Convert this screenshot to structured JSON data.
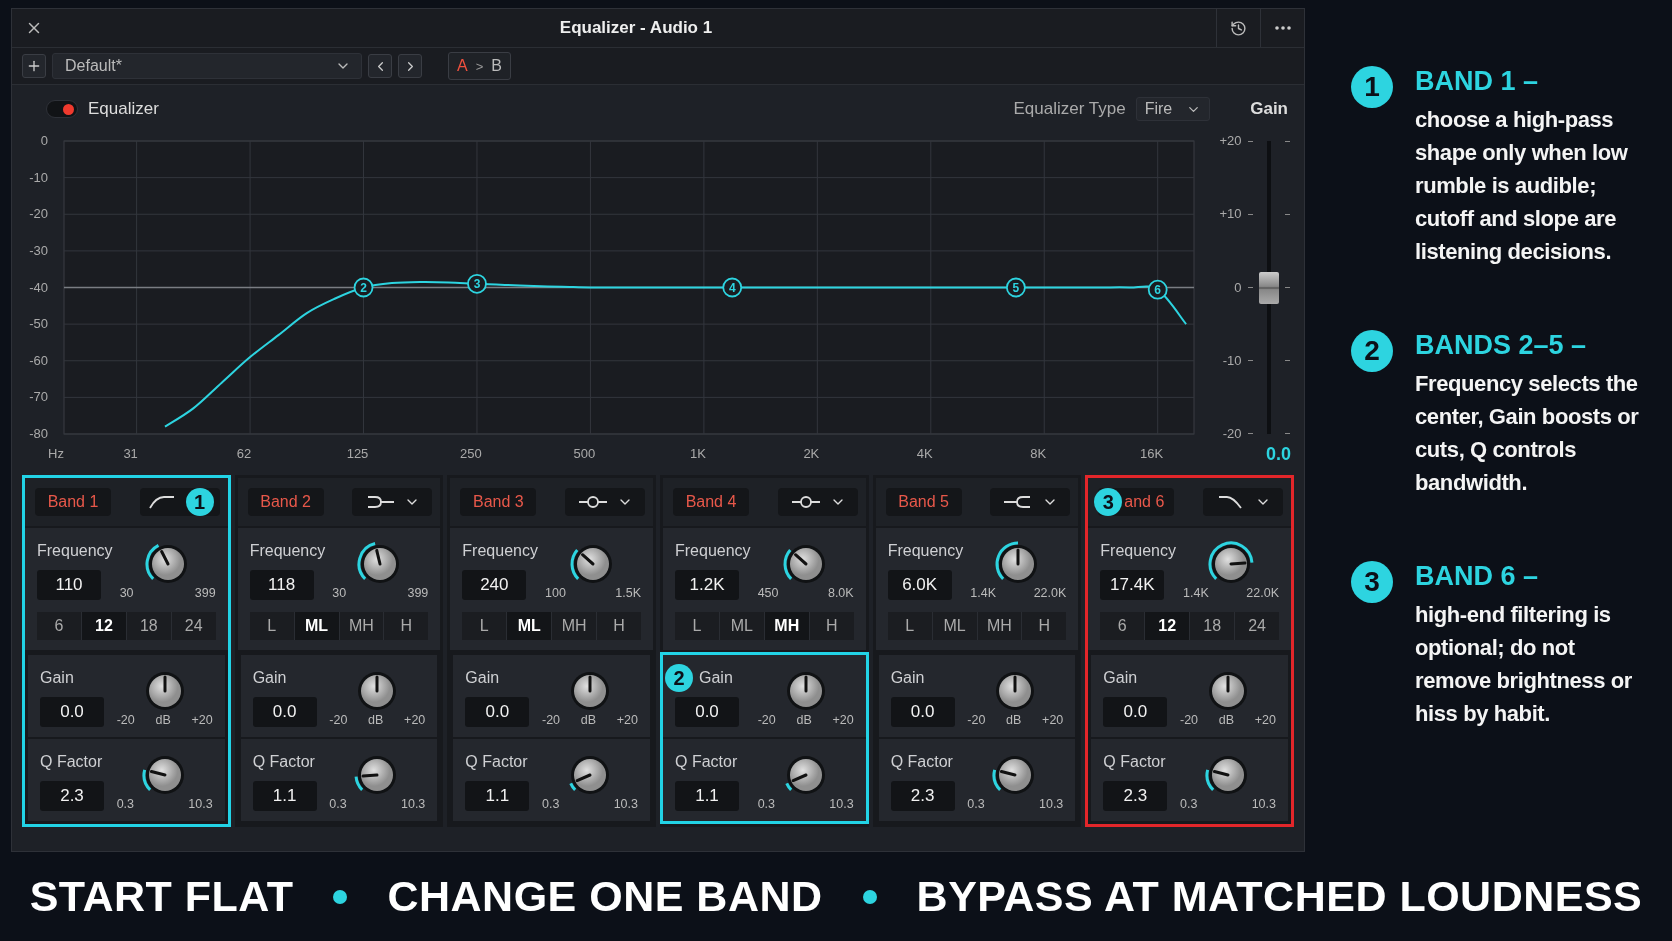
{
  "window": {
    "title": "Equalizer - Audio 1"
  },
  "toolbar": {
    "preset": "Default*",
    "compare": {
      "items": [
        {
          "label": "A",
          "selected": true
        },
        {
          "label": "B",
          "selected": false
        }
      ],
      "separator": ">"
    }
  },
  "equalizer": {
    "label": "Equalizer",
    "on": true,
    "type_label": "Equalizer Type",
    "type_value": "Fire",
    "gain_label": "Gain"
  },
  "graph": {
    "chart_data": {
      "type": "line",
      "xlabel": "Hz",
      "ylim": [
        -80,
        0
      ],
      "grid": true,
      "ref_lines": [
        {
          "axis": "y",
          "value": -40
        }
      ],
      "categories": [
        "31",
        null,
        null,
        null,
        "62",
        null,
        null,
        null,
        "125",
        null,
        null,
        null,
        "250",
        null,
        null,
        null,
        "500",
        null,
        null,
        null,
        "1K",
        null,
        null,
        null,
        "2K",
        null,
        null,
        null,
        "4K",
        null,
        null,
        null,
        "8K",
        null,
        null,
        null,
        "16K",
        null
      ],
      "yticks": [
        0,
        -10,
        -20,
        -30,
        -40,
        -50,
        -60,
        -70,
        -80
      ],
      "series": [
        {
          "color": "#2dd4e0",
          "values": [
            null,
            -78,
            -73,
            -66,
            -59,
            -53,
            -47,
            -43,
            -40,
            -38.8,
            -38.5,
            -38.6,
            -39,
            -39.3,
            -39.6,
            -39.8,
            -40,
            -40,
            -40,
            -40,
            -40,
            -40,
            -40,
            -40,
            -40,
            -40,
            -40,
            -40,
            -40,
            -40,
            -40,
            -40,
            -40,
            -40,
            -40,
            -40,
            -40.6,
            -50
          ]
        }
      ],
      "annotations": [
        "2",
        "3",
        "4",
        "5",
        "6"
      ]
    }
  },
  "gain_fader": {
    "scale": [
      "+20",
      "+10",
      "0",
      "-10",
      "-20"
    ],
    "level": 0.5,
    "reading": "0.0"
  },
  "bands": [
    {
      "label": "Band 1",
      "filter": {
        "kind": "highpass",
        "badge": "1"
      },
      "highlight": {
        "color": "#22d3e6"
      },
      "frequency": {
        "label": "Frequency",
        "value": "110",
        "min": "30",
        "max": "399"
      },
      "options": [
        {
          "label": "6",
          "selected": false
        },
        {
          "label": "12",
          "selected": true
        },
        {
          "label": "18",
          "selected": false
        },
        {
          "label": "24",
          "selected": false
        }
      ],
      "gain": {
        "label": "Gain",
        "value": "0.0",
        "min": "-20",
        "unit": "dB",
        "max": "+20"
      },
      "q": {
        "label": "Q Factor",
        "value": "2.3",
        "min": "0.3",
        "max": "10.3"
      }
    },
    {
      "label": "Band 2",
      "filter": {
        "kind": "lowshelf"
      },
      "frequency": {
        "label": "Frequency",
        "value": "118",
        "min": "30",
        "max": "399"
      },
      "options": [
        {
          "label": "L",
          "selected": false
        },
        {
          "label": "ML",
          "selected": true
        },
        {
          "label": "MH",
          "selected": false
        },
        {
          "label": "H",
          "selected": false
        }
      ],
      "gain": {
        "label": "Gain",
        "value": "0.0",
        "min": "-20",
        "unit": "dB",
        "max": "+20"
      },
      "q": {
        "label": "Q Factor",
        "value": "1.1",
        "min": "0.3",
        "max": "10.3"
      }
    },
    {
      "label": "Band 3",
      "filter": {
        "kind": "bell"
      },
      "frequency": {
        "label": "Frequency",
        "value": "240",
        "min": "100",
        "max": "1.5K"
      },
      "options": [
        {
          "label": "L",
          "selected": false
        },
        {
          "label": "ML",
          "selected": true
        },
        {
          "label": "MH",
          "selected": false
        },
        {
          "label": "H",
          "selected": false
        }
      ],
      "gain": {
        "label": "Gain",
        "value": "0.0",
        "min": "-20",
        "unit": "dB",
        "max": "+20"
      },
      "q": {
        "label": "Q Factor",
        "value": "1.1",
        "min": "0.3",
        "max": "10.3"
      }
    },
    {
      "label": "Band 4",
      "filter": {
        "kind": "bell"
      },
      "controls_highlight": {
        "color": "#22d3e6"
      },
      "frequency": {
        "label": "Frequency",
        "value": "1.2K",
        "min": "450",
        "max": "8.0K"
      },
      "options": [
        {
          "label": "L",
          "selected": false
        },
        {
          "label": "ML",
          "selected": false
        },
        {
          "label": "MH",
          "selected": true
        },
        {
          "label": "H",
          "selected": false
        }
      ],
      "gain": {
        "label": "Gain",
        "badge": "2",
        "value": "0.0",
        "min": "-20",
        "unit": "dB",
        "max": "+20"
      },
      "q": {
        "label": "Q Factor",
        "value": "1.1",
        "min": "0.3",
        "max": "10.3"
      }
    },
    {
      "label": "Band 5",
      "filter": {
        "kind": "highshelf"
      },
      "frequency": {
        "label": "Frequency",
        "value": "6.0K",
        "min": "1.4K",
        "max": "22.0K"
      },
      "options": [
        {
          "label": "L",
          "selected": false
        },
        {
          "label": "ML",
          "selected": false
        },
        {
          "label": "MH",
          "selected": false
        },
        {
          "label": "H",
          "selected": false
        }
      ],
      "gain": {
        "label": "Gain",
        "value": "0.0",
        "min": "-20",
        "unit": "dB",
        "max": "+20"
      },
      "q": {
        "label": "Q Factor",
        "value": "2.3",
        "min": "0.3",
        "max": "10.3"
      }
    },
    {
      "label": "and 6",
      "label_badge": "3",
      "filter": {
        "kind": "lowpass"
      },
      "highlight": {
        "color": "#e3262a"
      },
      "frequency": {
        "label": "Frequency",
        "value": "17.4K",
        "min": "1.4K",
        "max": "22.0K"
      },
      "options": [
        {
          "label": "6",
          "selected": false
        },
        {
          "label": "12",
          "selected": true
        },
        {
          "label": "18",
          "selected": false
        },
        {
          "label": "24",
          "selected": false
        }
      ],
      "gain": {
        "label": "Gain",
        "value": "0.0",
        "min": "-20",
        "unit": "dB",
        "max": "+20"
      },
      "q": {
        "label": "Q Factor",
        "value": "2.3",
        "min": "0.3",
        "max": "10.3"
      }
    }
  ],
  "notes": [
    {
      "number": "1",
      "title": "BAND 1 –",
      "text": "choose a high-pass shape only when low rumble is audible; cutoff and slope are listening decisions."
    },
    {
      "number": "2",
      "title": "BANDS 2–5 –",
      "text": "Frequency selects the center, Gain boosts or cuts, Q controls bandwidth."
    },
    {
      "number": "3",
      "title": "BAND 6 –",
      "text": "high-end filtering is optional; do not remove brightness or hiss by habit."
    }
  ],
  "banner": [
    "START FLAT",
    "CHANGE ONE BAND",
    "BYPASS AT MATCHED LOUDNESS"
  ]
}
